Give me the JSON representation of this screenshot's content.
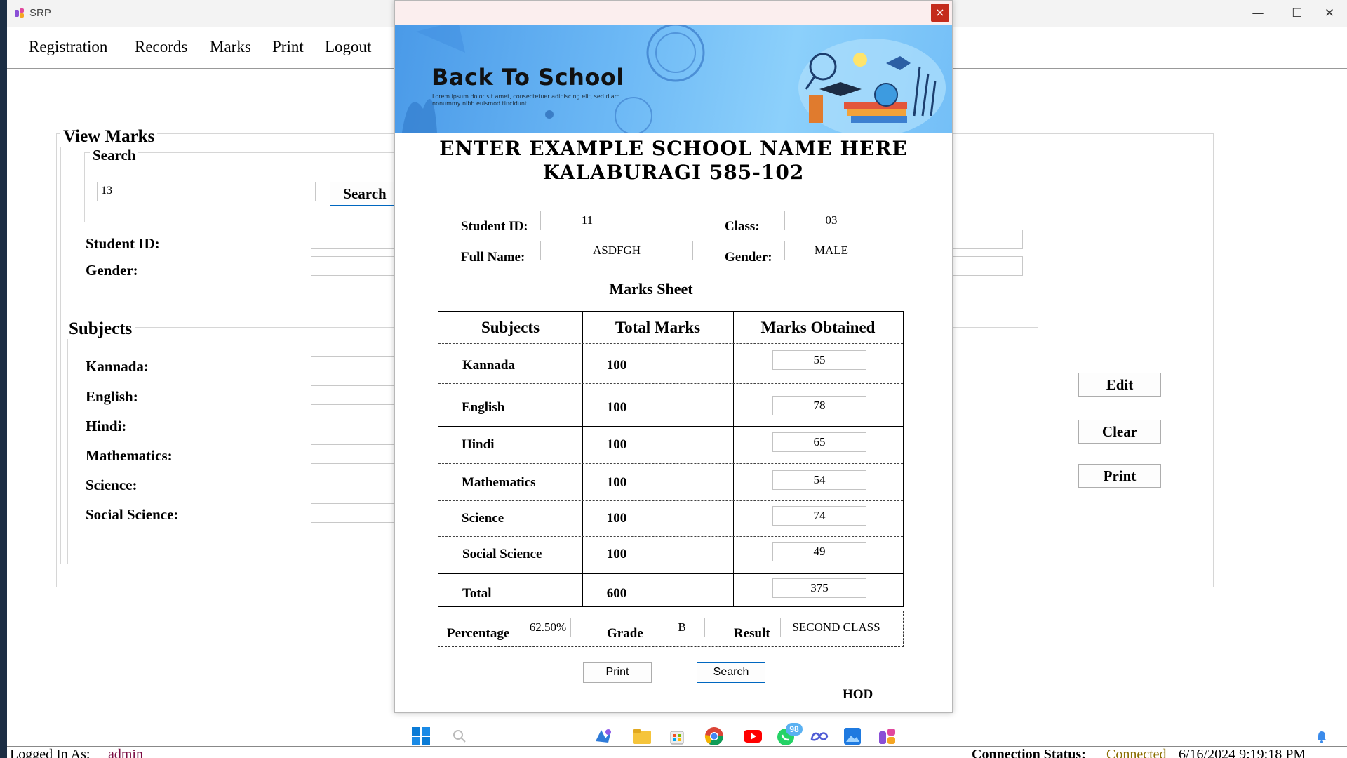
{
  "window": {
    "app_title": "SRP"
  },
  "menu": [
    "Registration",
    "Records",
    "Marks",
    "Print",
    "Logout"
  ],
  "view_marks": {
    "legend": "View Marks",
    "search_legend": "Search",
    "search_value": "13",
    "search_button": "Search",
    "student_id_label": "Student ID:",
    "gender_label": "Gender:",
    "subjects_legend": "Subjects",
    "subject_labels": [
      "Kannada:",
      "English:",
      "Hindi:",
      "Mathematics:",
      "Science:",
      "Social Science:"
    ],
    "buttons": {
      "edit": "Edit",
      "clear": "Clear",
      "print": "Print"
    }
  },
  "dialog": {
    "close_glyph": "×",
    "banner_title": "Back To School",
    "banner_sub": "Lorem ipsum dolor sit amet, consectetuer adipiscing elit, sed diam nonummy nibh euismod tincidunt",
    "school_line1": "ENTER EXAMPLE SCHOOL NAME HERE",
    "school_line2": "KALABURAGI 585-102",
    "student_id_label": "Student ID:",
    "student_id": "11",
    "class_label": "Class:",
    "class": "03",
    "full_name_label": "Full Name:",
    "full_name": "ASDFGH",
    "gender_label": "Gender:",
    "gender": "MALE",
    "marks_sheet_title": "Marks Sheet",
    "table_headers": [
      "Subjects",
      "Total Marks",
      "Marks Obtained"
    ],
    "rows": [
      {
        "subject": "Kannada",
        "total": "100",
        "obtained": "55"
      },
      {
        "subject": "English",
        "total": "100",
        "obtained": "78"
      },
      {
        "subject": "Hindi",
        "total": "100",
        "obtained": "65"
      },
      {
        "subject": "Mathematics",
        "total": "100",
        "obtained": "54"
      },
      {
        "subject": "Science",
        "total": "100",
        "obtained": "74"
      },
      {
        "subject": "Social Science",
        "total": "100",
        "obtained": "49"
      },
      {
        "subject": "Total",
        "total": "600",
        "obtained": "375"
      }
    ],
    "percentage_label": "Percentage",
    "percentage": "62.50%",
    "grade_label": "Grade",
    "grade": "B",
    "result_label": "Result",
    "result": "SECOND CLASS",
    "print_button": "Print",
    "search_button": "Search",
    "signature": "HOD"
  },
  "statusbar": {
    "logged_in_label": "Logged In As:",
    "user": "admin",
    "connection_label": "Connection Status:",
    "connection_value": "Connected",
    "datetime": "6/16/2024 9:19:18 PM"
  },
  "taskbar": {
    "whatsapp_badge": "98"
  },
  "colors": {
    "close": "#c42b1c",
    "banner": "#6cb8f5",
    "link": "#7b0c42"
  }
}
